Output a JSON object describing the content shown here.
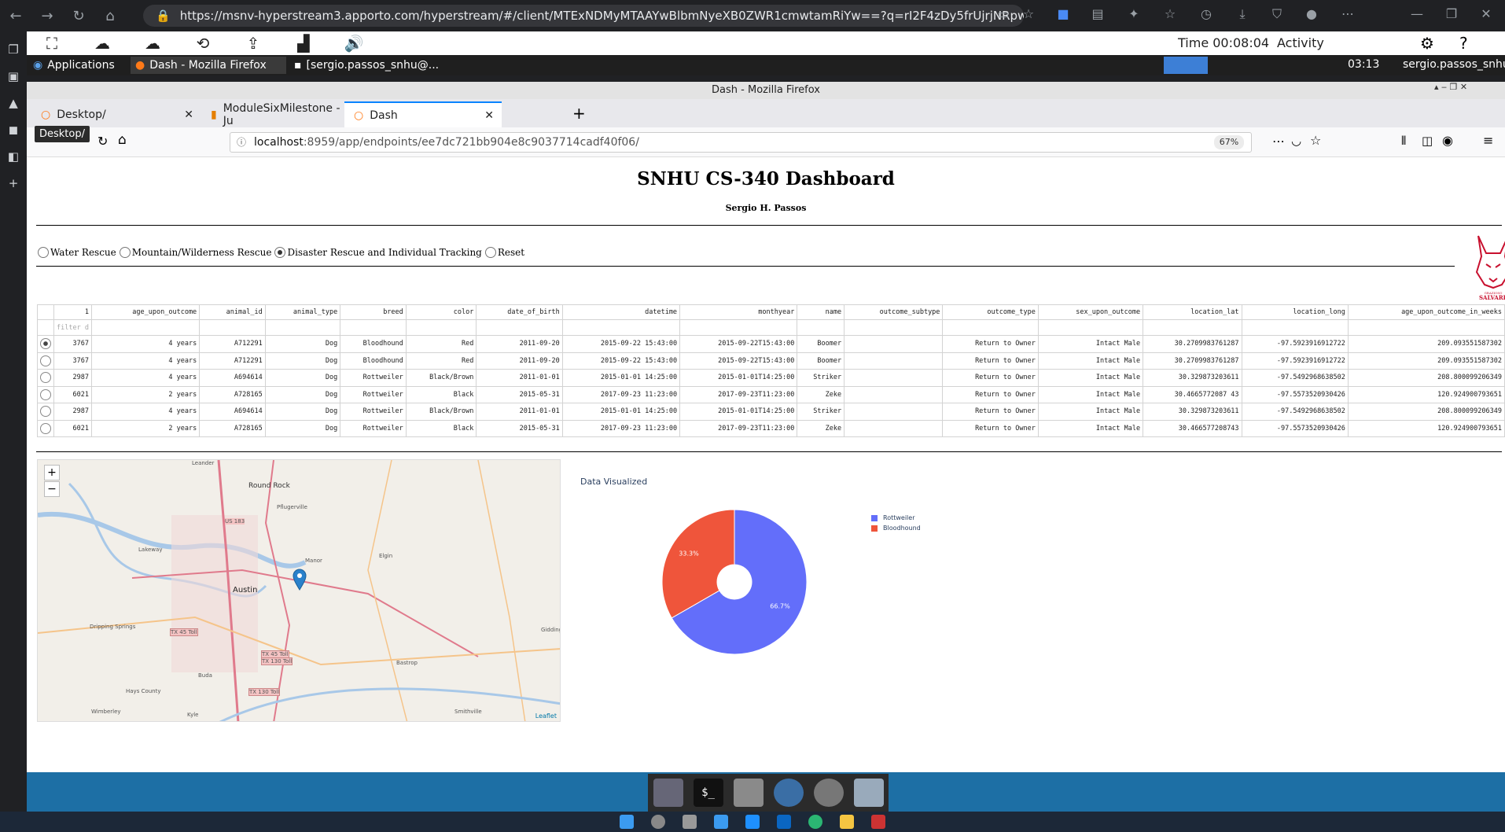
{
  "browser": {
    "outer_url": "https://msnv-hyperstream3.apporto.com/hyperstream/#/client/MTExNDMyMTAAYwBlbmNyeXB0ZWR1cmwtamRiYw==?q=rI2F4zDy5frUjrjNRpwCE6vxo25OQwZD...",
    "outer_url_host": "msnv-hyperstream3.apporto.com"
  },
  "session": {
    "time": "Time 00:08:04",
    "activity": "Activity"
  },
  "panel": {
    "applications": "Applications",
    "task1": "Dash - Mozilla Firefox",
    "task2": "[sergio.passos_snhu@...",
    "clock": "03:13",
    "user": "sergio.passos_snhu"
  },
  "firefox": {
    "window_title": "Dash - Mozilla Firefox",
    "tabs": [
      {
        "label": "Desktop/"
      },
      {
        "label": "ModuleSixMilestone - Ju"
      },
      {
        "label": "Dash"
      }
    ],
    "tooltip": "Desktop/",
    "url_host": "localhost",
    "url_rest": ":8959/app/endpoints/ee7dc721bb904e8c9037714cadf40f06/",
    "zoom": "67%"
  },
  "dashboard": {
    "title": "SNHU CS-340 Dashboard",
    "author": "Sergio H. Passos",
    "radios": [
      {
        "label": "Water Rescue",
        "checked": false
      },
      {
        "label": "Mountain/Wilderness Rescue",
        "checked": false
      },
      {
        "label": "Disaster Rescue and Individual Tracking",
        "checked": true
      },
      {
        "label": "Reset",
        "checked": false
      }
    ],
    "logo_text": [
      "GRAZIOSO",
      "SALVARE"
    ],
    "filter_placeholder": "filter d",
    "columns": [
      "1",
      "age_upon_outcome",
      "animal_id",
      "animal_type",
      "breed",
      "color",
      "date_of_birth",
      "datetime",
      "monthyear",
      "name",
      "outcome_subtype",
      "outcome_type",
      "sex_upon_outcome",
      "location_lat",
      "location_long",
      "age_upon_outcome_in_weeks"
    ],
    "rows": [
      [
        "3767",
        "4 years",
        "A712291",
        "Dog",
        "Bloodhound",
        "Red",
        "2011-09-20",
        "2015-09-22 15:43:00",
        "2015-09-22T15:43:00",
        "Boomer",
        "",
        "Return to Owner",
        "Intact Male",
        "30.2709983761287",
        "-97.5923916912722",
        "209.093551587302"
      ],
      [
        "3767",
        "4 years",
        "A712291",
        "Dog",
        "Bloodhound",
        "Red",
        "2011-09-20",
        "2015-09-22 15:43:00",
        "2015-09-22T15:43:00",
        "Boomer",
        "",
        "Return to Owner",
        "Intact Male",
        "30.2709983761287",
        "-97.5923916912722",
        "209.093551587302"
      ],
      [
        "2987",
        "4 years",
        "A694614",
        "Dog",
        "Rottweiler",
        "Black/Brown",
        "2011-01-01",
        "2015-01-01 14:25:00",
        "2015-01-01T14:25:00",
        "Striker",
        "",
        "Return to Owner",
        "Intact Male",
        "30.329873203611",
        "-97.5492968638502",
        "208.800099206349"
      ],
      [
        "6021",
        "2 years",
        "A728165",
        "Dog",
        "Rottweiler",
        "Black",
        "2015-05-31",
        "2017-09-23 11:23:00",
        "2017-09-23T11:23:00",
        "Zeke",
        "",
        "Return to Owner",
        "Intact Male",
        "30.4665772087 43",
        "-97.5573520930426",
        "120.924900793651"
      ],
      [
        "2987",
        "4 years",
        "A694614",
        "Dog",
        "Rottweiler",
        "Black/Brown",
        "2011-01-01",
        "2015-01-01 14:25:00",
        "2015-01-01T14:25:00",
        "Striker",
        "",
        "Return to Owner",
        "Intact Male",
        "30.329873203611",
        "-97.5492968638502",
        "208.800099206349"
      ],
      [
        "6021",
        "2 years",
        "A728165",
        "Dog",
        "Rottweiler",
        "Black",
        "2015-05-31",
        "2017-09-23 11:23:00",
        "2017-09-23T11:23:00",
        "Zeke",
        "",
        "Return to Owner",
        "Intact Male",
        "30.466577208743",
        "-97.5573520930426",
        "120.924900793651"
      ]
    ],
    "selected_row": 0,
    "map": {
      "zoom_in": "+",
      "zoom_out": "−",
      "attribution": "Leaflet",
      "labels": [
        "Leander",
        "Round Rock",
        "Pflugerville",
        "US 183",
        "Lakeway",
        "Manor",
        "Elgin",
        "Austin",
        "Dripping Springs",
        "TX 45 Toll",
        "TX 45 Toll",
        "TX 130 Toll",
        "Hays County",
        "Bastrop",
        "Buda",
        "Kyle",
        "Wimberley",
        "Giddings",
        "Smithville",
        "TX 130 Toll"
      ]
    },
    "chart_title": "Data Visualized"
  },
  "chart_data": {
    "type": "pie",
    "title": "Data Visualized",
    "categories": [
      "Rottweiler",
      "Bloodhound"
    ],
    "values": [
      66.7,
      33.3
    ],
    "labels": [
      "66.7%",
      "33.3%"
    ],
    "colors": [
      "#636efa",
      "#ef553b"
    ],
    "hole": true,
    "legend": "right"
  }
}
